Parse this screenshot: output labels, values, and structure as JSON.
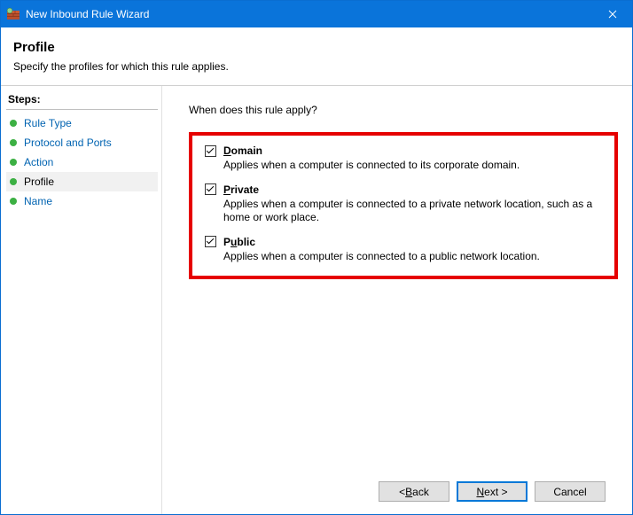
{
  "window": {
    "title": "New Inbound Rule Wizard"
  },
  "header": {
    "heading": "Profile",
    "subheading": "Specify the profiles for which this rule applies."
  },
  "steps": {
    "title": "Steps:",
    "items": [
      {
        "label": "Rule Type",
        "active": false
      },
      {
        "label": "Protocol and Ports",
        "active": false
      },
      {
        "label": "Action",
        "active": false
      },
      {
        "label": "Profile",
        "active": true
      },
      {
        "label": "Name",
        "active": false
      }
    ]
  },
  "content": {
    "question": "When does this rule apply?",
    "options": [
      {
        "key": "domain",
        "label_pre": "",
        "label_u": "D",
        "label_post": "omain",
        "checked": true,
        "desc": "Applies when a computer is connected to its corporate domain."
      },
      {
        "key": "private",
        "label_pre": "",
        "label_u": "P",
        "label_post": "rivate",
        "checked": true,
        "desc": "Applies when a computer is connected to a private network location, such as a home or work place."
      },
      {
        "key": "public",
        "label_pre": "P",
        "label_u": "u",
        "label_post": "blic",
        "checked": true,
        "desc": "Applies when a computer is connected to a public network location."
      }
    ]
  },
  "buttons": {
    "back_pre": "< ",
    "back_u": "B",
    "back_post": "ack",
    "next_pre": "",
    "next_u": "N",
    "next_post": "ext >",
    "cancel": "Cancel"
  }
}
